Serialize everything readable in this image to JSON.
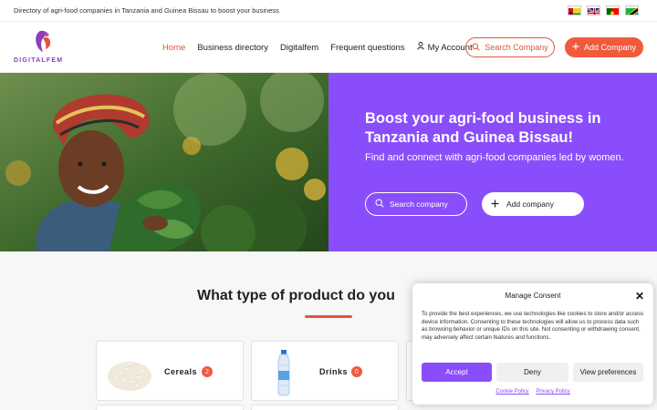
{
  "topbar": {
    "text": "Directory of agri-food companies in Tanzania and Guinea Bissau to boost your business",
    "flags": [
      "guinea-bissau-flag",
      "uk-flag",
      "portugal-flag",
      "tanzania-flag"
    ]
  },
  "header": {
    "logo_text": "DIGITALFEM",
    "nav": [
      {
        "label": "Home",
        "active": true
      },
      {
        "label": "Business directory",
        "active": false
      },
      {
        "label": "Digitalfem",
        "active": false
      },
      {
        "label": "Frequent questions",
        "active": false
      },
      {
        "label": "My Account",
        "active": false,
        "icon": "user-icon"
      }
    ],
    "search_button": "Search Company",
    "add_button": "Add Company"
  },
  "hero": {
    "title": "Boost your agri-food business in Tanzania and Guinea Bissau!",
    "subtitle": "Find and connect with agri-food companies led by women.",
    "search_button": "Search company",
    "add_button": "Add company",
    "panel_color": "#8a4dfb"
  },
  "section": {
    "title": "What type of product do you",
    "categories": [
      {
        "label": "Cereals",
        "count": "2",
        "icon": "rice-grains-image"
      },
      {
        "label": "Drinks",
        "count": "0",
        "icon": "water-bottle-image"
      }
    ]
  },
  "consent": {
    "title": "Manage Consent",
    "text": "To provide the best experiences, we use technologies like cookies to store and/or access device information. Consenting to these technologies will allow us to process data such as browsing behavior or unique IDs on this site. Not consenting or withdrawing consent, may adversely affect certain features and functions.",
    "accept": "Accept",
    "deny": "Deny",
    "preferences": "View preferences",
    "cookie_policy": "Cookie Policy",
    "privacy_policy": "Privacy Policy"
  },
  "colors": {
    "accent": "#ef5a3c",
    "purple": "#8a4dfb"
  }
}
